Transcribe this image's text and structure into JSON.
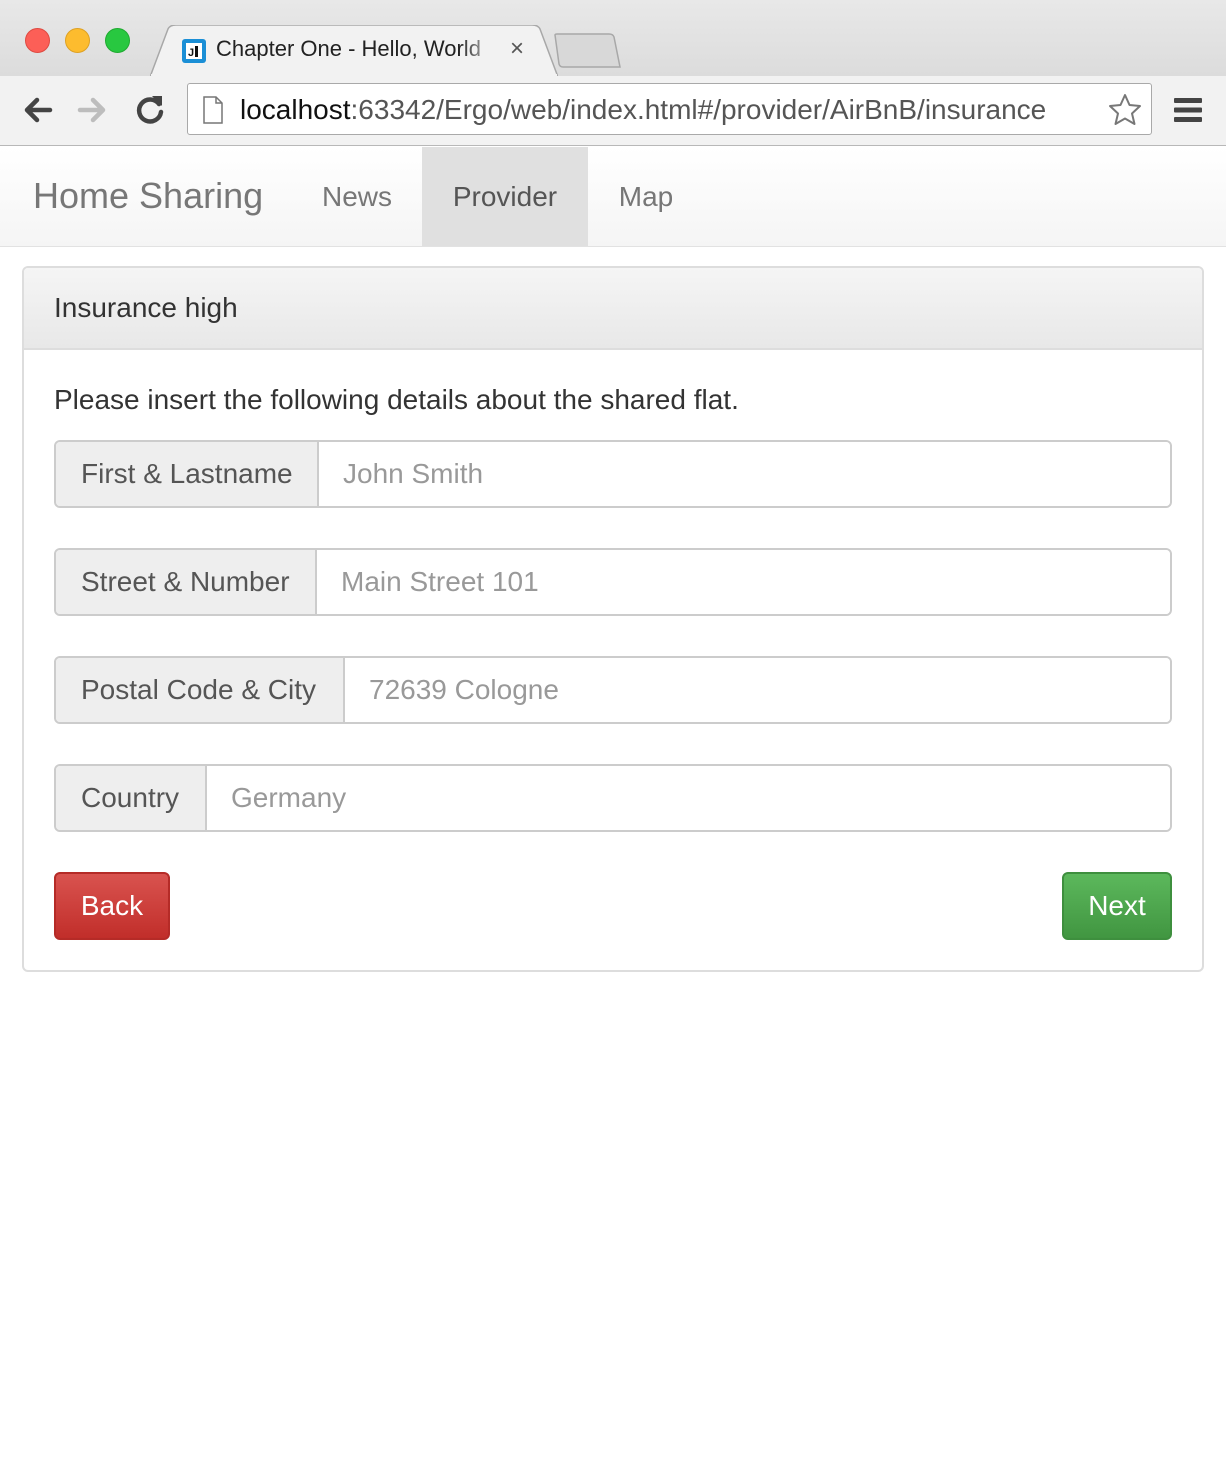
{
  "browser": {
    "tab": {
      "title": "Chapter One - Hello, World",
      "close_glyph": "×",
      "favicon": "webstorm-icon"
    },
    "url": {
      "host": "localhost",
      "path": ":63342/Ergo/web/index.html#/provider/AirBnB/insurance"
    },
    "icons": [
      "back-arrow-icon",
      "forward-arrow-icon",
      "reload-icon",
      "page-icon",
      "star-icon",
      "menu-icon"
    ]
  },
  "navbar": {
    "brand": "Home Sharing",
    "items": [
      {
        "label": "News",
        "active": false
      },
      {
        "label": "Provider",
        "active": true
      },
      {
        "label": "Map",
        "active": false
      }
    ]
  },
  "panel": {
    "title": "Insurance high",
    "intro": "Please insert the following details about the shared flat.",
    "fields": [
      {
        "label": "First & Lastname",
        "placeholder": "John Smith",
        "value": ""
      },
      {
        "label": "Street & Number",
        "placeholder": "Main Street 101",
        "value": ""
      },
      {
        "label": "Postal Code & City",
        "placeholder": "72639 Cologne",
        "value": ""
      },
      {
        "label": "Country",
        "placeholder": "Germany",
        "value": ""
      }
    ],
    "back_label": "Back",
    "next_label": "Next"
  },
  "colors": {
    "back_button": "#d9534f",
    "next_button": "#5cb85c",
    "active_nav": "#e0e0e0"
  }
}
